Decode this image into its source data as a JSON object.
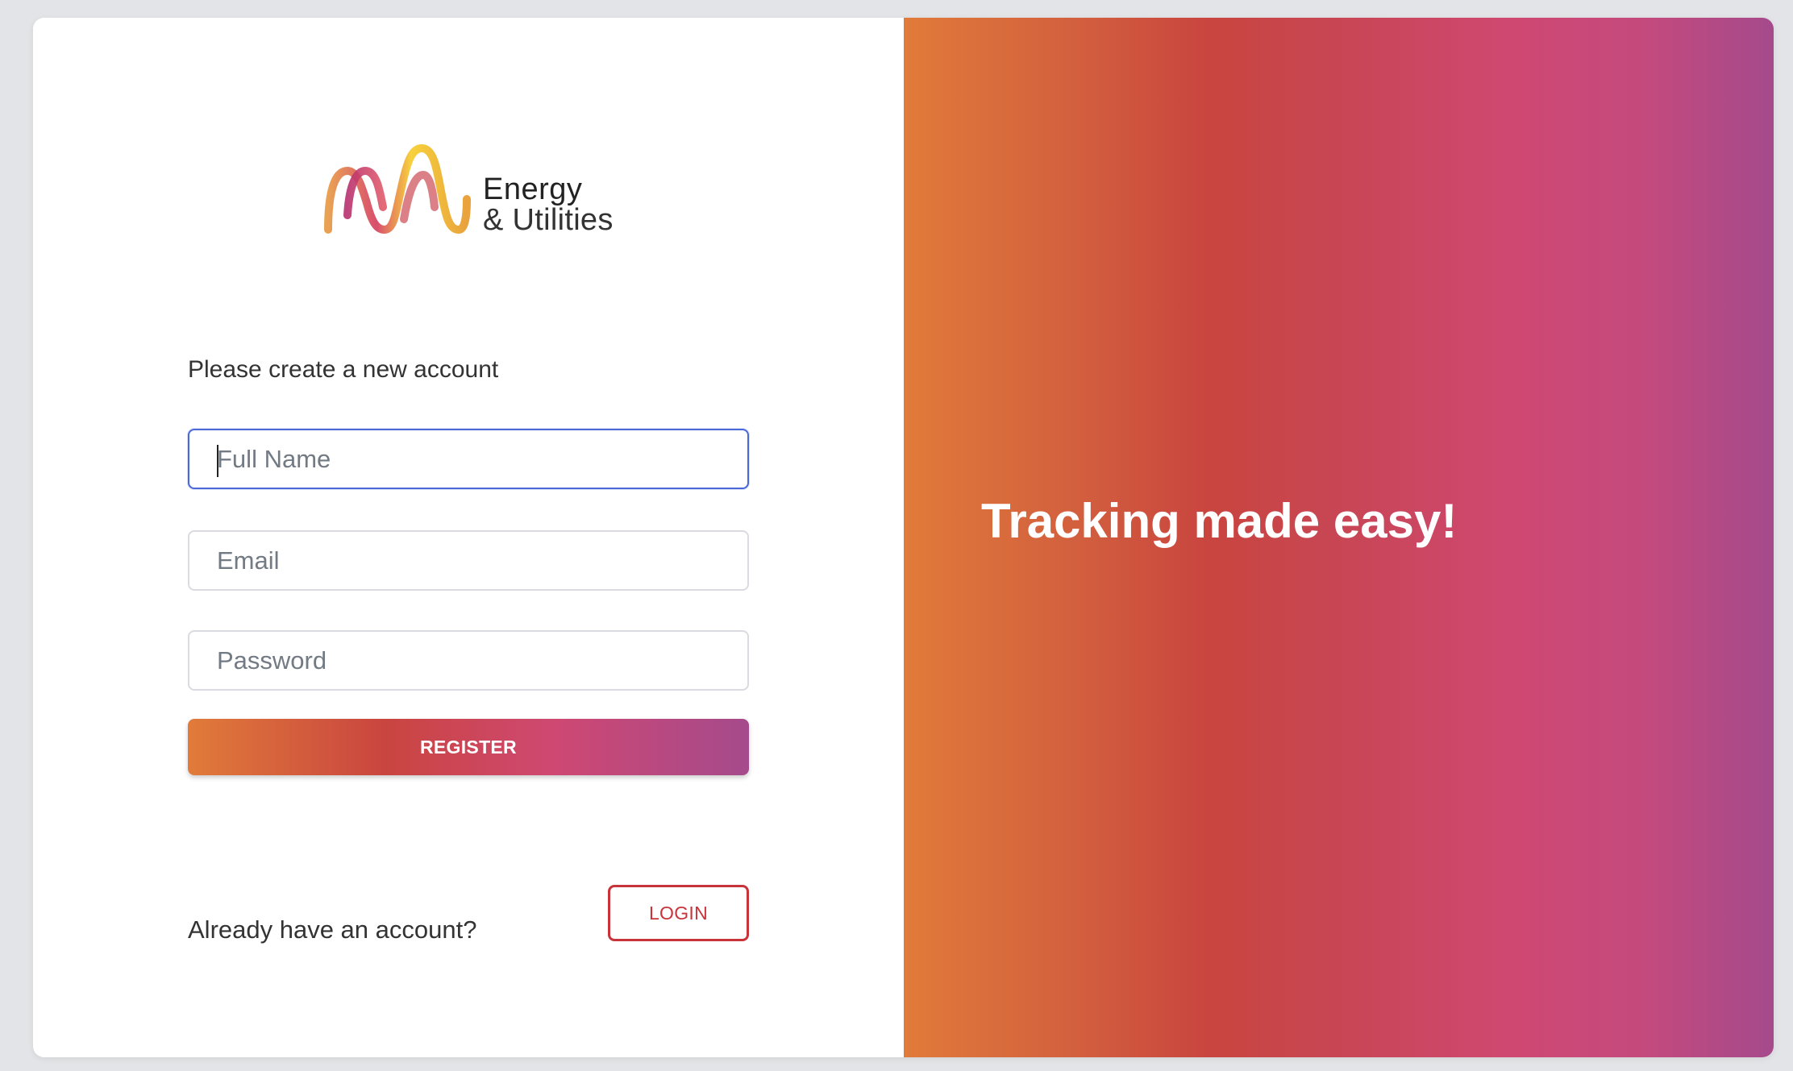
{
  "brand": {
    "line1": "Energy",
    "line2": "& Utilities",
    "logo_icon": "wave-logo-icon"
  },
  "form": {
    "heading": "Please create a new account",
    "full_name_placeholder": "Full Name",
    "email_placeholder": "Email",
    "password_placeholder": "Password",
    "register_label": "REGISTER"
  },
  "footer": {
    "prompt": "Already have an account?",
    "login_label": "LOGIN"
  },
  "hero": {
    "tagline": "Tracking made easy!"
  },
  "colors": {
    "accent_orange": "#e17b3a",
    "accent_red": "#c9453f",
    "accent_pink": "#cf4872",
    "accent_purple": "#a54a8c",
    "login_border": "#c8343a",
    "focus_blue": "#4a69d6"
  }
}
